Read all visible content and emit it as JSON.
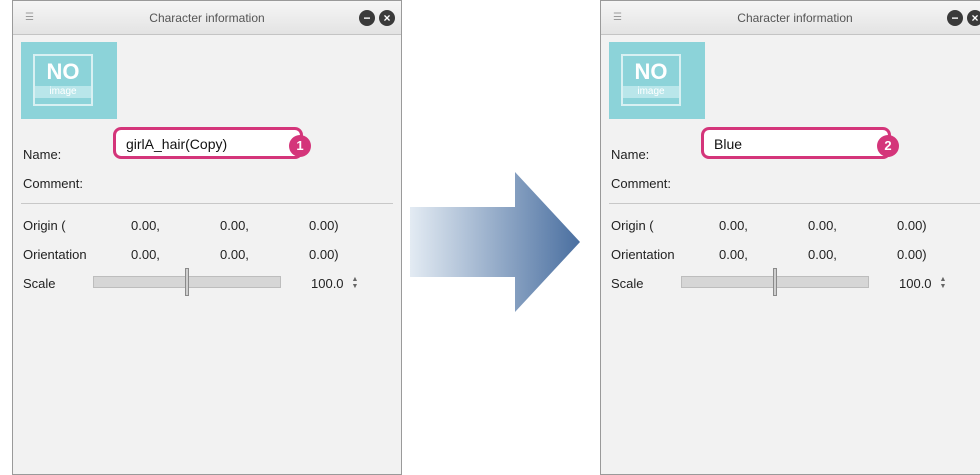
{
  "panels": [
    {
      "title": "Character information",
      "thumbnail": {
        "no": "NO",
        "image": "image"
      },
      "name_label": "Name:",
      "name_value": "girlA_hair(Copy)",
      "comment_label": "Comment:",
      "origin": {
        "label": "Origin (",
        "x": "0.00,",
        "y": "0.00,",
        "z": "0.00)"
      },
      "orientation": {
        "label": "Orientation",
        "x": "0.00,",
        "y": "0.00,",
        "z": "0.00)"
      },
      "scale": {
        "label": "Scale",
        "value": "100.0",
        "level": 0.5
      },
      "step_badge": "1"
    },
    {
      "title": "Character information",
      "thumbnail": {
        "no": "NO",
        "image": "image"
      },
      "name_label": "Name:",
      "name_value": "Blue",
      "comment_label": "Comment:",
      "origin": {
        "label": "Origin (",
        "x": "0.00,",
        "y": "0.00,",
        "z": "0.00)"
      },
      "orientation": {
        "label": "Orientation",
        "x": "0.00,",
        "y": "0.00,",
        "z": "0.00)"
      },
      "scale": {
        "label": "Scale",
        "value": "100.0",
        "level": 0.5
      },
      "step_badge": "2"
    }
  ],
  "colors": {
    "highlight": "#d4357a",
    "arrow_start": "#d9e3ef",
    "arrow_end": "#4a6fa0"
  }
}
